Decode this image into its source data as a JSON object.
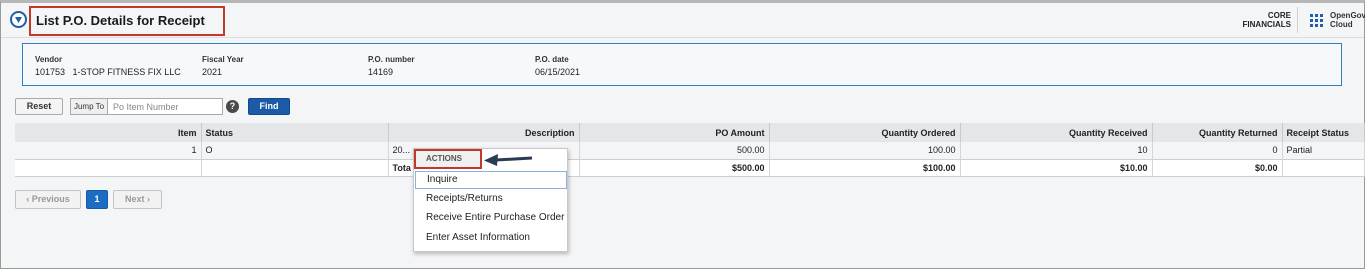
{
  "header": {
    "title": "List P.O. Details for Receipt",
    "brand_line1": "CORE",
    "brand_line2": "FINANCIALS",
    "cloud_line1": "OpenGov",
    "cloud_line2": "Cloud"
  },
  "info": {
    "vendor_label": "Vendor",
    "vendor_value": "101753   1-STOP FITNESS FIX LLC",
    "fiscal_year_label": "Fiscal Year",
    "fiscal_year_value": "2021",
    "po_number_label": "P.O. number",
    "po_number_value": "14169",
    "po_date_label": "P.O. date",
    "po_date_value": "06/15/2021"
  },
  "toolbar": {
    "reset_label": "Reset",
    "jump_to_label": "Jump To",
    "jump_placeholder": "Po Item Number",
    "help_label": "?",
    "find_label": "Find"
  },
  "table": {
    "columns": [
      "Item",
      "Status",
      "Description",
      "PO Amount",
      "Quantity Ordered",
      "Quantity Received",
      "Quantity Returned",
      "Receipt Status"
    ],
    "rows": [
      [
        "1",
        "O",
        "20...",
        "500.00",
        "100.00",
        "10",
        "0",
        "Partial"
      ]
    ],
    "total_label": "Tota",
    "totals": [
      "$500.00",
      "$100.00",
      "$10.00",
      "$0.00"
    ]
  },
  "pagination": {
    "previous": "‹ Previous",
    "page": "1",
    "next": "Next ›"
  },
  "actions": {
    "heading": "ACTIONS",
    "items": [
      "Inquire",
      "Receipts/Returns",
      "Receive Entire Purchase Order",
      "Enter Asset Information"
    ]
  }
}
